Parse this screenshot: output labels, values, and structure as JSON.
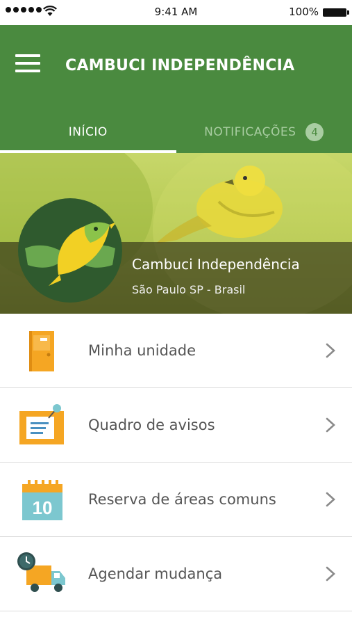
{
  "status_bar": {
    "time": "9:41 AM",
    "battery": "100%",
    "icons": [
      "signal-icon",
      "wifi-icon",
      "battery-icon"
    ]
  },
  "header": {
    "title": "CAMBUCI INDEPENDÊNCIA",
    "menu_icon": "hamburger-menu-icon",
    "background_color": "#4a8a3f"
  },
  "tabs": [
    {
      "label": "INÍCIO",
      "active": true
    },
    {
      "label": "NOTIFICAÇÕES",
      "active": false,
      "badge": "4"
    }
  ],
  "hero": {
    "name": "Cambuci Independência",
    "location": "São Paulo SP - Brasil",
    "logo_icon": "bird-leaf-logo-icon"
  },
  "menu": [
    {
      "label": "Minha unidade",
      "icon": "door-icon"
    },
    {
      "label": "Quadro de avisos",
      "icon": "notice-board-icon"
    },
    {
      "label": "Reserva de áreas comuns",
      "icon": "calendar-icon",
      "icon_text": "10"
    },
    {
      "label": "Agendar mudança",
      "icon": "moving-truck-icon"
    }
  ],
  "colors": {
    "primary_green": "#4a8a3f",
    "tab_inactive": "#a9cda2",
    "icon_orange": "#f5a623",
    "icon_teal": "#7cc7cf"
  }
}
